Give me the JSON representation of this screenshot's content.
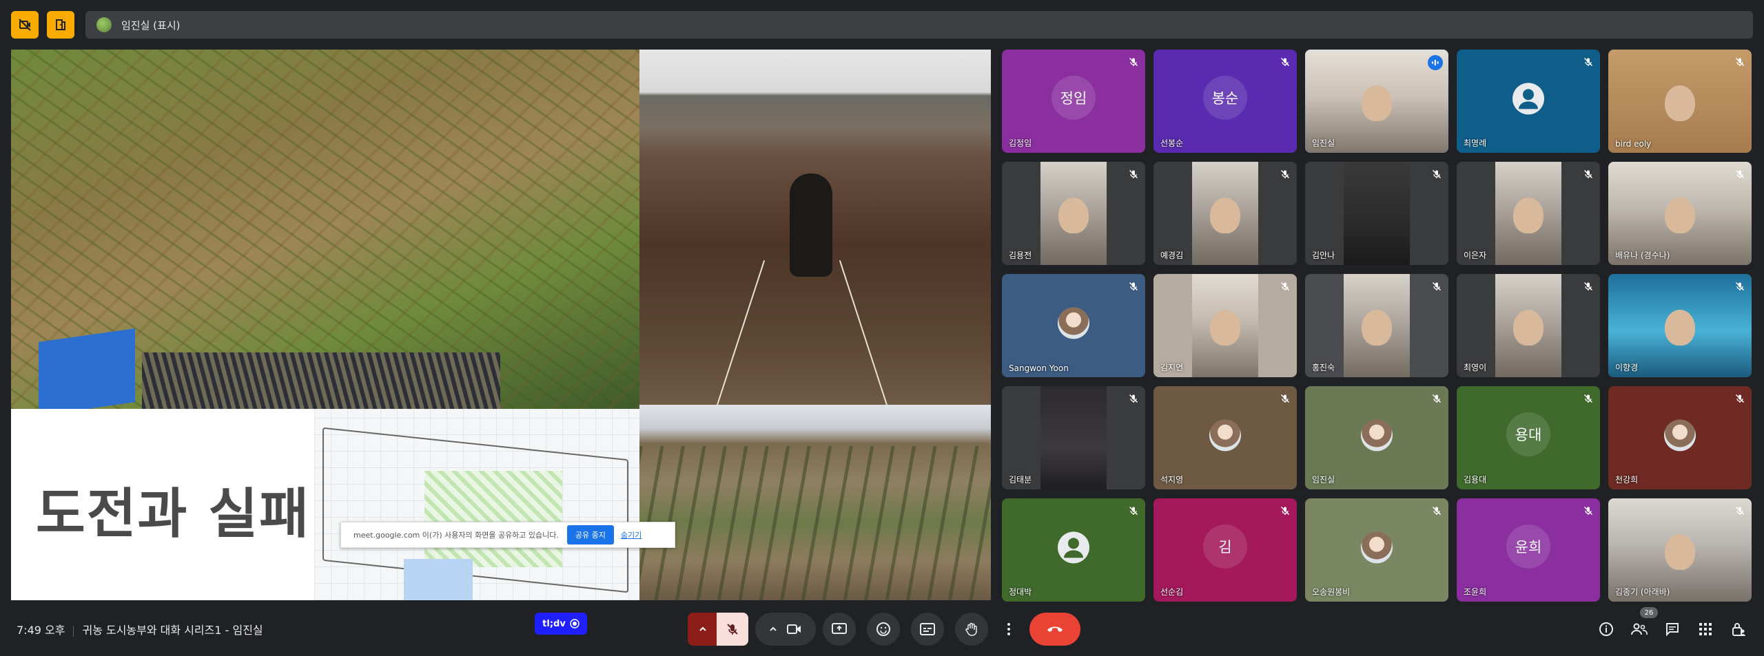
{
  "top": {
    "presenter_label": "임진실 (표시)"
  },
  "presentation": {
    "slide_title": "도전과 실패",
    "share_notice": {
      "message": "meet.google.com 이(가) 사용자의 화면을 공유하고 있습니다.",
      "stop_label": "공유 중지",
      "hide_label": "숨기기"
    }
  },
  "participants": [
    {
      "name": "김정임",
      "initials": "정임",
      "bg": "#8b2fa0"
    },
    {
      "name": "선봉순",
      "initials": "봉순",
      "bg": "#5a2bb0"
    },
    {
      "name": "임진실",
      "bg": "#d9cfc4"
    },
    {
      "name": "최명례",
      "bg": "#0f5e8a"
    },
    {
      "name": "bird eoly",
      "bg": "#b88a57"
    },
    {
      "name": "김용전",
      "bg": "#3a3b3d"
    },
    {
      "name": "예경김",
      "bg": "#3a3b3d"
    },
    {
      "name": "김안나",
      "bg": "#3a3b3d"
    },
    {
      "name": "이은자",
      "bg": "#3a3b3d"
    },
    {
      "name": "배유나 (경수나)",
      "bg": "#9b9e99"
    },
    {
      "name": "Sangwon Yoon",
      "bg": "#3c5c84"
    },
    {
      "name": "김지연",
      "bg": "#b5aba0"
    },
    {
      "name": "홍진숙",
      "bg": "#4a4b4e"
    },
    {
      "name": "최영이",
      "bg": "#3a3b3d"
    },
    {
      "name": "이향경",
      "bg": "#2f7fa6"
    },
    {
      "name": "김태분",
      "bg": "#3a3b3d"
    },
    {
      "name": "석지영",
      "bg": "#6e5a43"
    },
    {
      "name": "임진실",
      "bg": "#6b7a55"
    },
    {
      "name": "김용대",
      "initials": "용대",
      "bg": "#3f6a2c"
    },
    {
      "name": "천강희",
      "bg": "#6e2a23"
    },
    {
      "name": "정대박",
      "bg": "#3f6a2c"
    },
    {
      "name": "선순김",
      "initials": "김",
      "bg": "#a3195b"
    },
    {
      "name": "오송원봉비",
      "bg": "#7a8762"
    },
    {
      "name": "조윤희",
      "initials": "윤희",
      "bg": "#8b2fa0"
    },
    {
      "name": "김종기 (아래바)",
      "bg": "#7c8ea0"
    }
  ],
  "bottom": {
    "time": "7:49 오후",
    "meeting_title": "귀농 도시농부와 대화 시리즈1 - 임진실",
    "tldv_label": "tl;dv",
    "people_count": "26"
  }
}
